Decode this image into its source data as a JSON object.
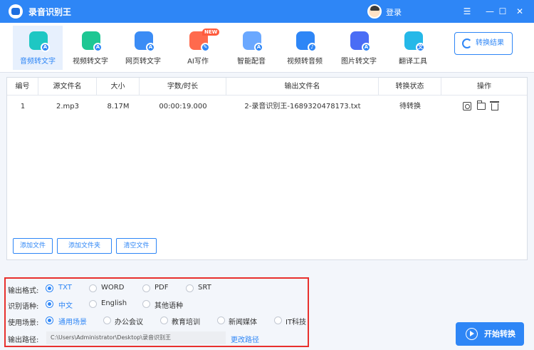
{
  "app": {
    "title": "录音识别王",
    "login_label": "登录"
  },
  "window_controls": [
    "☰",
    "—",
    "☐",
    "✕"
  ],
  "toolbar": {
    "tools": [
      {
        "label": "音频转文字",
        "icon": "audio-to-text-icon",
        "color": "#1ec7c3"
      },
      {
        "label": "视频转文字",
        "icon": "video-to-text-icon",
        "color": "#1ec793"
      },
      {
        "label": "网页转文字",
        "icon": "web-to-text-icon",
        "color": "#3b8cf5"
      },
      {
        "label": "AI写作",
        "icon": "ai-writing-icon",
        "color": "#ff6a4d"
      },
      {
        "label": "智能配音",
        "icon": "smart-dubbing-icon",
        "color": "#6aa8ff"
      },
      {
        "label": "视频转音频",
        "icon": "video-to-audio-icon",
        "color": "#2e86f6"
      },
      {
        "label": "图片转文字",
        "icon": "image-to-text-icon",
        "color": "#4a6df5"
      },
      {
        "label": "翻译工具",
        "icon": "translate-icon",
        "color": "#25b8e8"
      }
    ],
    "new_badge": "NEW",
    "result_button": "转换结果"
  },
  "table": {
    "headers": [
      "编号",
      "源文件名",
      "大小",
      "字数/时长",
      "输出文件名",
      "转换状态",
      "操作"
    ],
    "rows": [
      {
        "index": "1",
        "source": "2.mp3",
        "size": "8.17M",
        "duration": "00:00:19.000",
        "output": "2-录音识别王-1689320478173.txt",
        "status": "待转换"
      }
    ]
  },
  "file_buttons": {
    "add_file": "添加文件",
    "add_folder": "添加文件夹",
    "clear_files": "清空文件"
  },
  "settings": {
    "format": {
      "label": "输出格式:",
      "options": [
        "TXT",
        "WORD",
        "PDF",
        "SRT"
      ],
      "selected": "TXT"
    },
    "language": {
      "label": "识别语种:",
      "options": [
        "中文",
        "English",
        "其他语种"
      ],
      "selected": "中文"
    },
    "scene": {
      "label": "使用场景:",
      "options": [
        "通用场景",
        "办公会议",
        "教育培训",
        "新闻媒体",
        "IT科技"
      ],
      "selected": "通用场景"
    },
    "path": {
      "label": "输出路径:",
      "value": "C:\\Users\\Administrator\\Desktop\\录音识别王",
      "change_label": "更改路径"
    }
  },
  "start_button": "开始转换"
}
